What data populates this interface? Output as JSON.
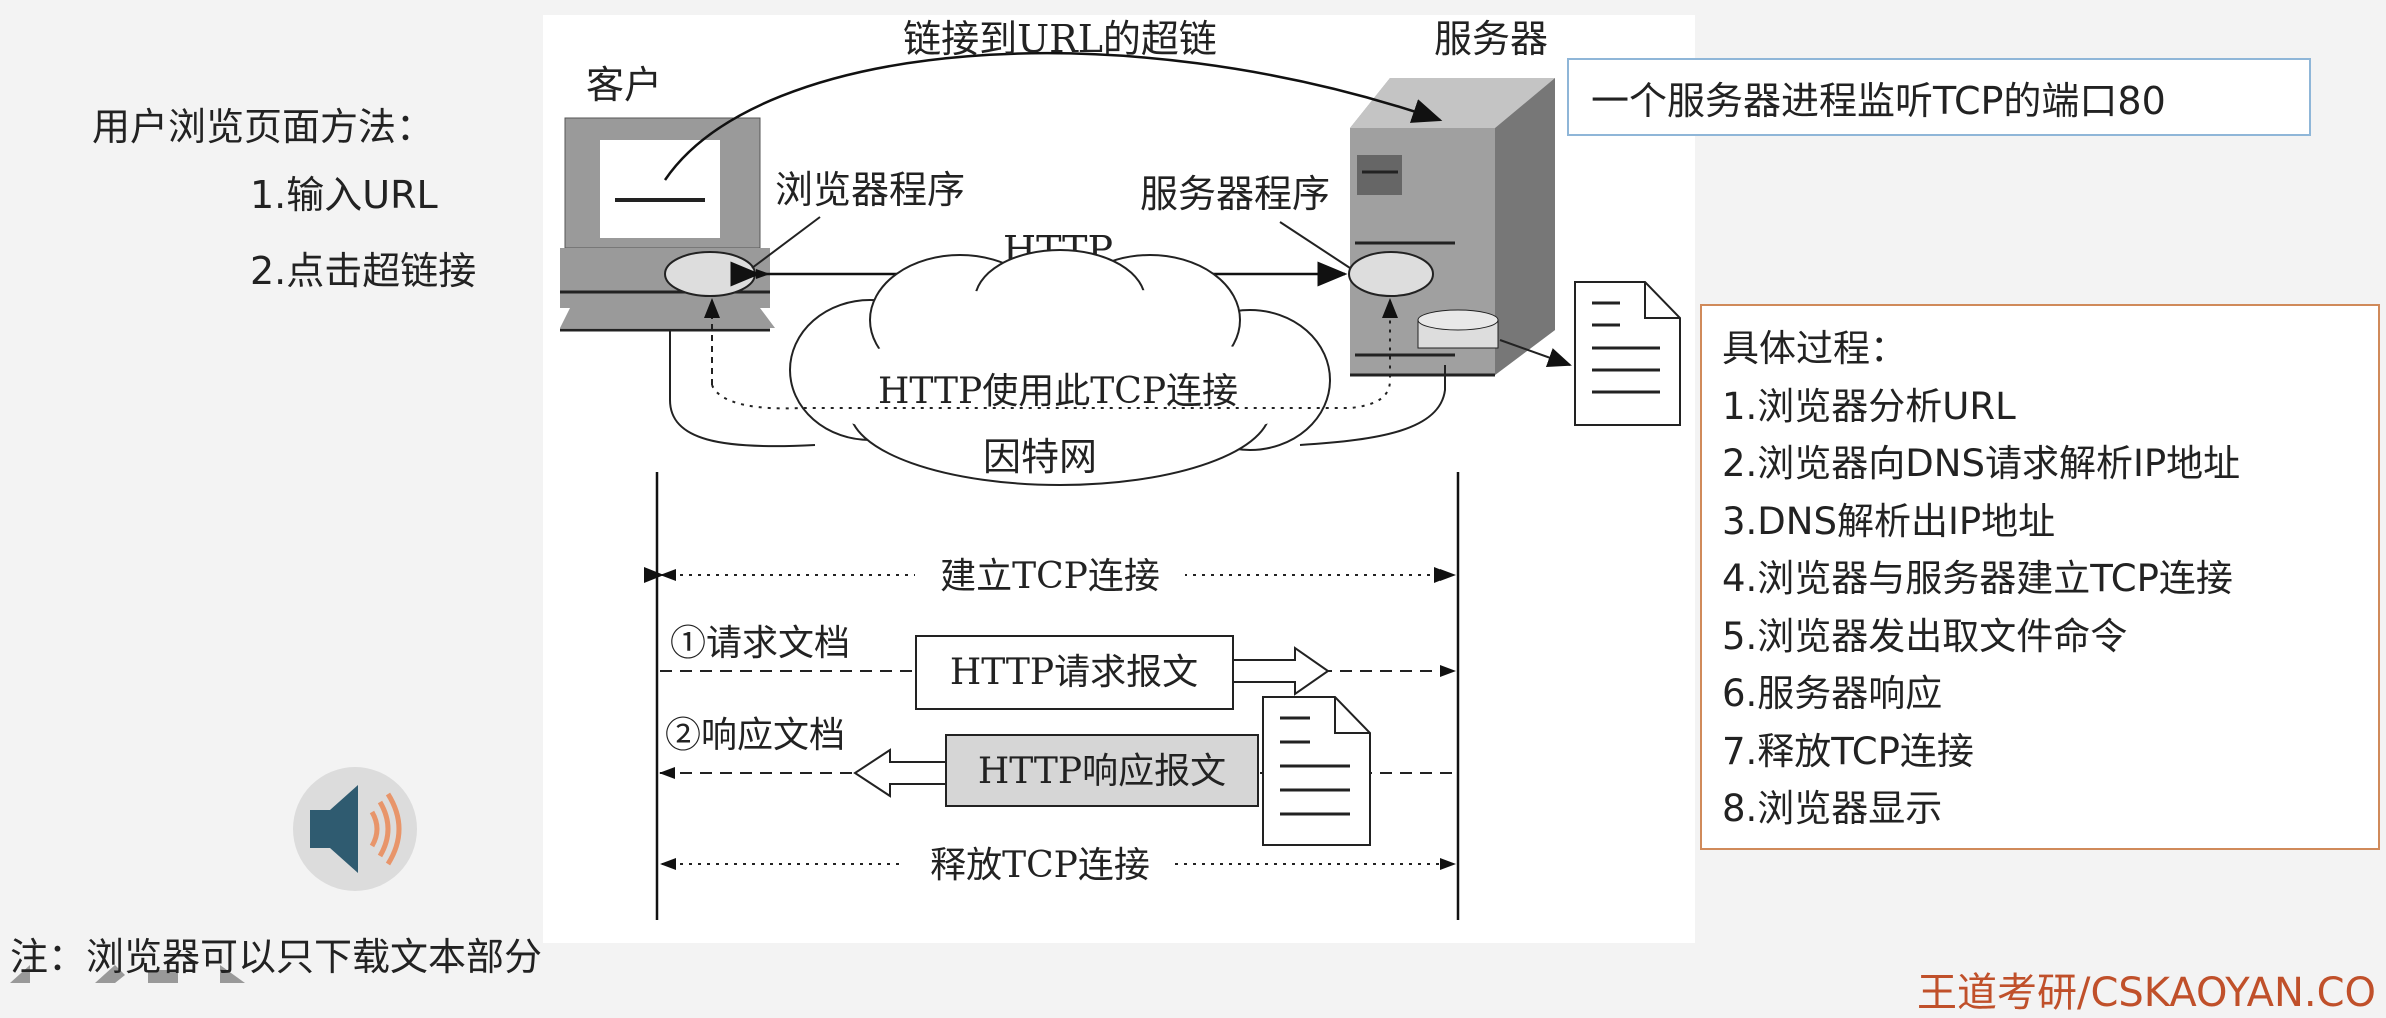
{
  "left_panel": {
    "title": "用户浏览页面方法：",
    "methods": [
      "1.输入URL",
      "2.点击超链接"
    ]
  },
  "diagram": {
    "client_label": "客户",
    "server_label": "服务器",
    "hyperlink_label": "链接到URL的超链",
    "browser_program": "浏览器程序",
    "server_program": "服务器程序",
    "http_label": "HTTP",
    "tcp_usage_label": "HTTP使用此TCP连接",
    "internet_label": "因特网",
    "establish_tcp": "建立TCP连接",
    "request_doc": "①请求文档",
    "request_msg": "HTTP请求报文",
    "response_doc": "②响应文档",
    "response_msg": "HTTP响应报文",
    "release_tcp": "释放TCP连接"
  },
  "server_note": "一个服务器进程监听TCP的端口80",
  "process": {
    "title": "具体过程：",
    "steps": [
      "1.浏览器分析URL",
      "2.浏览器向DNS请求解析IP地址",
      "3.DNS解析出IP地址",
      "4.浏览器与服务器建立TCP连接",
      "5.浏览器发出取文件命令",
      "6.服务器响应",
      "7.释放TCP连接",
      "8.浏览器显示"
    ]
  },
  "footnote": "注：浏览器可以只下载文本部分",
  "watermark": "王道考研/CSKAOYAN.CO",
  "colors": {
    "accent_orange": "#c0502a",
    "speaker_blue": "#2f5b70",
    "speaker_waves": "#e8956a"
  }
}
